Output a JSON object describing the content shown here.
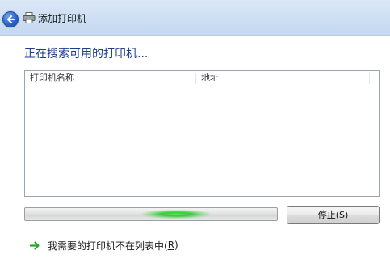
{
  "window": {
    "title": "添加打印机",
    "back_icon": "back-arrow-icon",
    "app_icon": "printer-icon"
  },
  "main": {
    "heading": "正在搜索可用的打印机...",
    "columns": [
      "打印机名称",
      "地址"
    ],
    "rows": []
  },
  "progress": {
    "state": "searching",
    "indicator_position": 0.6,
    "colors": {
      "fill": "#3cc93c"
    }
  },
  "buttons": {
    "stop_label": "停止(",
    "stop_accel": "S",
    "stop_close": ")"
  },
  "link": {
    "icon": "green-arrow-icon",
    "label": "我需要的打印机不在列表中(",
    "accel": "R",
    "close": ")"
  }
}
